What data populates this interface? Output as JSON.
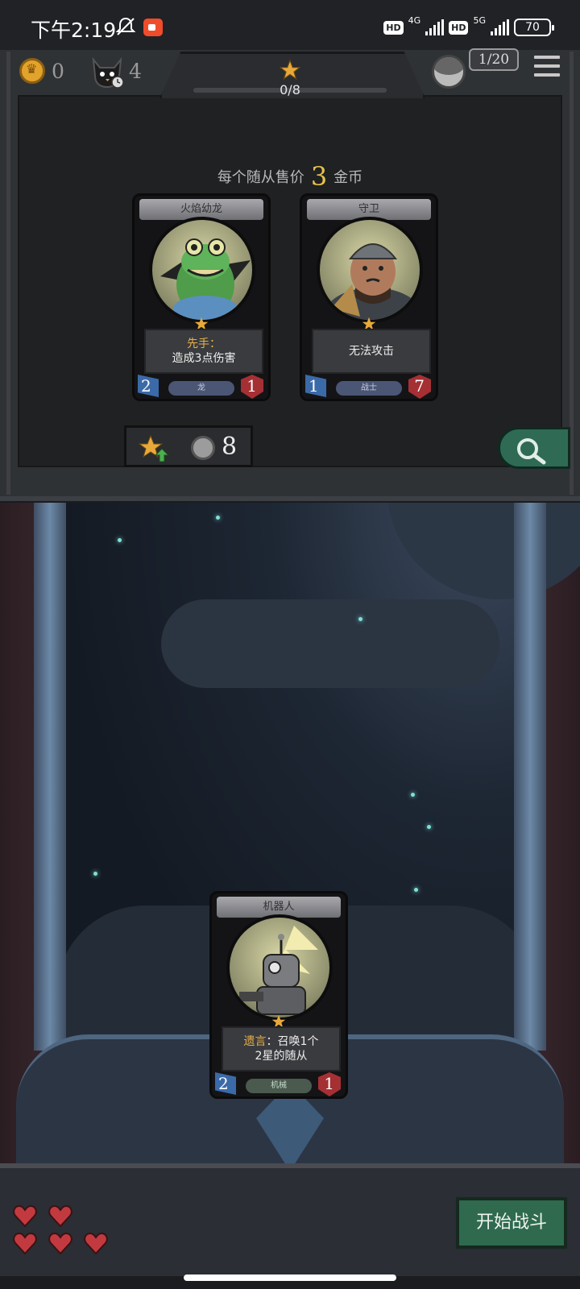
{
  "status_bar": {
    "time": "下午2:19",
    "hd1": "HD",
    "net1": "4G",
    "hd2": "HD",
    "net2": "5G",
    "battery": "70"
  },
  "hud": {
    "gold": "0",
    "turn": "4",
    "stars_progress": "0/8",
    "players": "1/20"
  },
  "shop": {
    "price_prefix": "每个随从售价",
    "price_value": "3",
    "price_suffix": "金币",
    "upgrade_cost": "8",
    "cards": [
      {
        "name": "火焰幼龙",
        "keyword": "先手",
        "text": "造成3点伤害",
        "attack": "2",
        "health": "1",
        "tribe": "龙",
        "stars": 1
      },
      {
        "name": "守卫",
        "keyword": "",
        "text": "无法攻击",
        "attack": "1",
        "health": "7",
        "tribe": "战士",
        "stars": 1
      }
    ]
  },
  "board": {
    "card": {
      "name": "机器人",
      "keyword": "遗言",
      "text1": "召唤1个",
      "text2": "2星的随从",
      "attack": "2",
      "health": "1",
      "tribe": "机械",
      "stars": 1
    }
  },
  "lives": 5,
  "start_button": "开始战斗",
  "colors": {
    "gold": "#e7c24a",
    "button_green": "#2f6a4e",
    "heart_red": "#c23a3f"
  }
}
